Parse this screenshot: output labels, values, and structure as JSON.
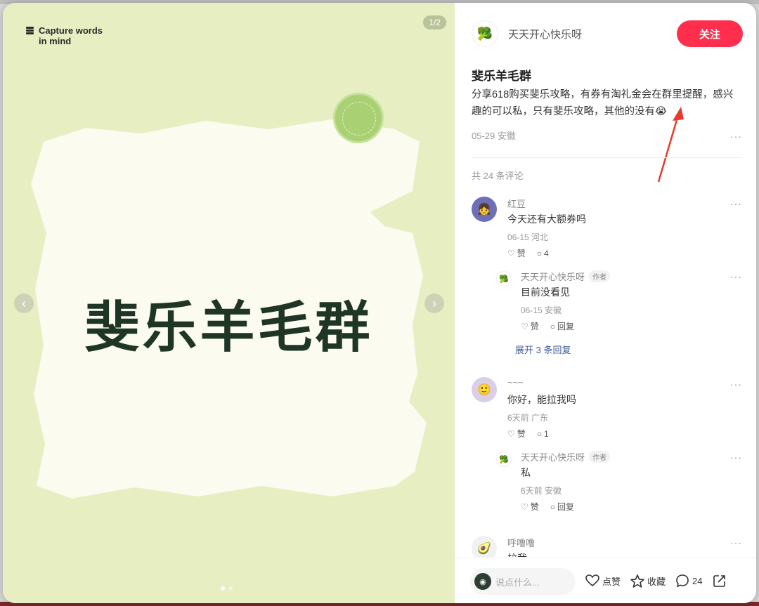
{
  "image_panel": {
    "brand_line1": "Capture words",
    "brand_line2": "in mind",
    "counter": "1/2",
    "hero_text": "斐乐羊毛群"
  },
  "author": {
    "name": "天天开心快乐呀",
    "follow_label": "关注"
  },
  "note": {
    "title": "斐乐羊毛群",
    "body": "分享618购买斐乐攻略，有券有淘礼金会在群里提醒，感兴趣的可以私，只有斐乐攻略，其他的没有😭",
    "meta": "05-29 安徽"
  },
  "comments_header": "共 24 条评论",
  "comments": [
    {
      "name": "红豆",
      "text": "今天还有大额券吗",
      "meta": "06-15 河北",
      "like_label": "赞",
      "reply_count": "4"
    },
    {
      "name": "天天开心快乐呀",
      "tag": "作者",
      "text": "目前没看见",
      "meta": "06-15 安徽",
      "like_label": "赞",
      "reply_label": "回复"
    },
    {
      "expand_label": "展开 3 条回复"
    },
    {
      "name": "~~~",
      "text": "你好，能拉我吗",
      "meta": "6天前 广东",
      "like_label": "赞",
      "reply_count": "1"
    },
    {
      "name": "天天开心快乐呀",
      "tag": "作者",
      "text": "私",
      "meta": "6天前 安徽",
      "like_label": "赞",
      "reply_label": "回复"
    },
    {
      "name": "呼噜噜",
      "text": "拉我"
    }
  ],
  "bottom_bar": {
    "comment_placeholder": "说点什么...",
    "like_label": "点赞",
    "collect_label": "收藏",
    "comment_count": "24"
  },
  "colors": {
    "accent": "#ff2e4d",
    "image_bg": "#e6eec2",
    "paper": "#fbfbef",
    "hero_text": "#1f3525"
  }
}
